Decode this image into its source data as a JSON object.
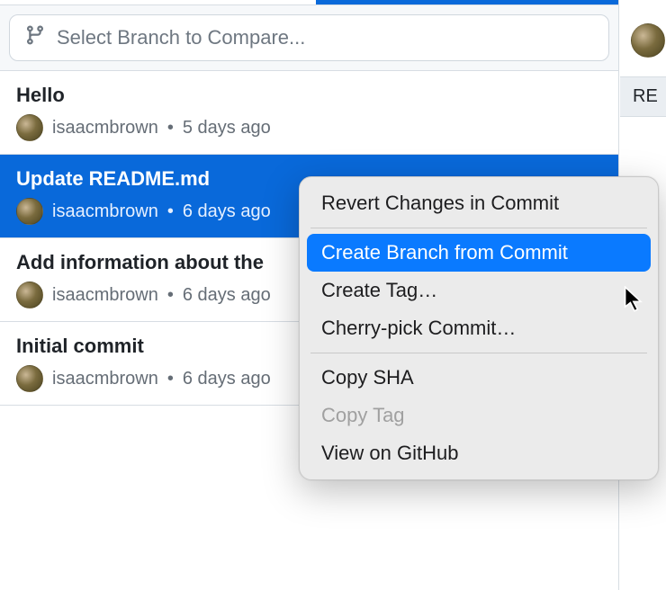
{
  "branch_selector": {
    "placeholder": "Select Branch to Compare..."
  },
  "commits": [
    {
      "title": "Hello",
      "author": "isaacmbrown",
      "time": "5 days ago",
      "selected": false
    },
    {
      "title": "Update README.md",
      "author": "isaacmbrown",
      "time": "6 days ago",
      "selected": true
    },
    {
      "title": "Add information about the",
      "author": "isaacmbrown",
      "time": "6 days ago",
      "selected": false
    },
    {
      "title": "Initial commit",
      "author": "isaacmbrown",
      "time": "6 days ago",
      "selected": false
    }
  ],
  "context_menu": {
    "items": [
      {
        "label": "Revert Changes in Commit",
        "highlighted": false,
        "enabled": true,
        "sep_after": true
      },
      {
        "label": "Create Branch from Commit",
        "highlighted": true,
        "enabled": true,
        "sep_after": false
      },
      {
        "label": "Create Tag…",
        "highlighted": false,
        "enabled": true,
        "sep_after": false
      },
      {
        "label": "Cherry-pick Commit…",
        "highlighted": false,
        "enabled": true,
        "sep_after": true
      },
      {
        "label": "Copy SHA",
        "highlighted": false,
        "enabled": true,
        "sep_after": false
      },
      {
        "label": "Copy Tag",
        "highlighted": false,
        "enabled": false,
        "sep_after": false
      },
      {
        "label": "View on GitHub",
        "highlighted": false,
        "enabled": true,
        "sep_after": false
      }
    ]
  },
  "right_panel": {
    "tab_label": "RE"
  }
}
